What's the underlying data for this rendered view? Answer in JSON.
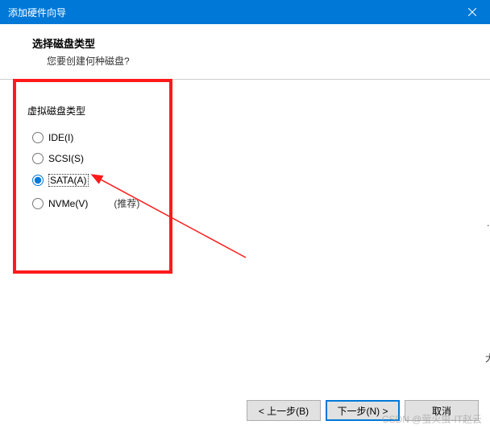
{
  "titlebar": {
    "title": "添加硬件向导"
  },
  "header": {
    "title": "选择磁盘类型",
    "subtitle": "您要创建何种磁盘?"
  },
  "content": {
    "group_label": "虚拟磁盘类型",
    "options": [
      {
        "label": "IDE(I)",
        "recommended": ""
      },
      {
        "label": "SCSI(S)",
        "recommended": ""
      },
      {
        "label": "SATA(A)",
        "recommended": ""
      },
      {
        "label": "NVMe(V)",
        "recommended": "(推荐)"
      }
    ],
    "selected_index": 2
  },
  "buttons": {
    "back": "< 上一步(B)",
    "next": "下一步(N) >",
    "cancel": "取消"
  },
  "watermark": "CSDN @萤火虫-IT赵云"
}
